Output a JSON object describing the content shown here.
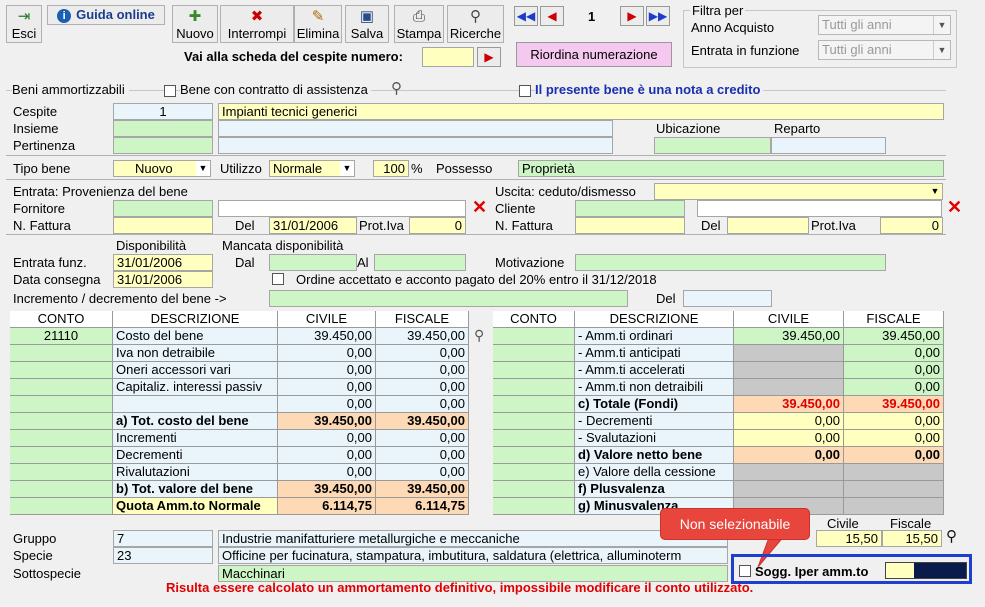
{
  "toolbar": {
    "esci": "Esci",
    "guida": "Guida online",
    "nuovo": "Nuovo",
    "interrompi": "Interrompi",
    "elimina": "Elimina",
    "salva": "Salva",
    "stampa": "Stampa",
    "ricerche": "Ricerche",
    "page": "1",
    "vai_label": "Vai alla scheda del cespite numero:",
    "riordina": "Riordina numerazione"
  },
  "filter": {
    "title": "Filtra per",
    "anno_label": "Anno Acquisto",
    "anno_value": "Tutti gli anni",
    "entrata_label": "Entrata in funzione",
    "entrata_value": "Tutti gli anni"
  },
  "beni": {
    "section": "Beni ammortizzabili",
    "assistenza": "Bene con contratto di assistenza",
    "nota_credito": "Il presente bene è una nota a credito",
    "cespite_label": "Cespite",
    "cespite_num": "1",
    "cespite_desc": "Impianti tecnici generici",
    "insieme_label": "Insieme",
    "pertinenza_label": "Pertinenza",
    "ubicazione_label": "Ubicazione",
    "reparto_label": "Reparto",
    "tipo_label": "Tipo bene",
    "tipo_value": "Nuovo",
    "utilizzo_label": "Utilizzo",
    "utilizzo_value": "Normale",
    "perc_value": "100",
    "perc_sign": "%",
    "possesso_label": "Possesso",
    "possesso_value": "Proprietà"
  },
  "entrata": {
    "provenienza": "Entrata: Provenienza del bene",
    "fornitore": "Fornitore",
    "nfattura": "N. Fattura",
    "del": "Del",
    "del_value": "31/01/2006",
    "protiva": "Prot.Iva",
    "protiva_value": "0"
  },
  "uscita": {
    "title": "Uscita: ceduto/dismesso",
    "cliente": "Cliente",
    "nfattura": "N. Fattura",
    "del": "Del",
    "protiva": "Prot.Iva",
    "protiva_value": "0"
  },
  "disp": {
    "disponibilita": "Disponibilità",
    "mancata": "Mancata disponibilità",
    "entrata_funz": "Entrata funz.",
    "entrata_funz_value": "31/01/2006",
    "data_consegna": "Data consegna",
    "data_consegna_value": "31/01/2006",
    "dal": "Dal",
    "al": "Al",
    "motivazione": "Motivazione",
    "ordine": "Ordine accettato e acconto pagato del 20% entro il 31/12/2018",
    "incremento": "Incremento / decremento del bene ->",
    "del": "Del"
  },
  "left_table": {
    "headers": [
      "CONTO",
      "DESCRIZIONE",
      "CIVILE",
      "FISCALE"
    ],
    "rows": [
      {
        "conto": "21110",
        "desc": "Costo del bene",
        "civile": "39.450,00",
        "fiscale": "39.450,00"
      },
      {
        "conto": "",
        "desc": "Iva non detraibile",
        "civile": "0,00",
        "fiscale": "0,00"
      },
      {
        "conto": "",
        "desc": "Oneri accessori vari",
        "civile": "0,00",
        "fiscale": "0,00"
      },
      {
        "conto": "",
        "desc": "Capitaliz. interessi passiv",
        "civile": "0,00",
        "fiscale": "0,00"
      },
      {
        "conto": "",
        "desc": "",
        "civile": "0,00",
        "fiscale": "0,00"
      },
      {
        "conto": "",
        "desc": "a) Tot. costo del bene",
        "civile": "39.450,00",
        "fiscale": "39.450,00"
      },
      {
        "conto": "",
        "desc": "Incrementi",
        "civile": "0,00",
        "fiscale": "0,00"
      },
      {
        "conto": "",
        "desc": "Decrementi",
        "civile": "0,00",
        "fiscale": "0,00"
      },
      {
        "conto": "",
        "desc": "Rivalutazioni",
        "civile": "0,00",
        "fiscale": "0,00"
      },
      {
        "conto": "",
        "desc": "b) Tot. valore del bene",
        "civile": "39.450,00",
        "fiscale": "39.450,00"
      },
      {
        "conto": "",
        "desc": "Quota Amm.to Normale",
        "civile": "6.114,75",
        "fiscale": "6.114,75"
      }
    ]
  },
  "right_table": {
    "headers": [
      "CONTO",
      "DESCRIZIONE",
      "CIVILE",
      "FISCALE"
    ],
    "rows": [
      {
        "desc": "- Amm.ti ordinari",
        "civile": "39.450,00",
        "fiscale": "39.450,00"
      },
      {
        "desc": "- Amm.ti anticipati",
        "civile": "",
        "fiscale": "0,00"
      },
      {
        "desc": "- Amm.ti accelerati",
        "civile": "",
        "fiscale": "0,00"
      },
      {
        "desc": "- Amm.ti non detraibili",
        "civile": "",
        "fiscale": "0,00"
      },
      {
        "desc": "c) Totale (Fondi)",
        "civile": "39.450,00",
        "fiscale": "39.450,00"
      },
      {
        "desc": "- Decrementi",
        "civile": "0,00",
        "fiscale": "0,00"
      },
      {
        "desc": "- Svalutazioni",
        "civile": "0,00",
        "fiscale": "0,00"
      },
      {
        "desc": "d) Valore netto bene",
        "civile": "0,00",
        "fiscale": "0,00"
      },
      {
        "desc": "e) Valore della cessione",
        "civile": "",
        "fiscale": ""
      },
      {
        "desc": "f) Plusvalenza",
        "civile": "",
        "fiscale": ""
      },
      {
        "desc": "g) Minusvalenza",
        "civile": "",
        "fiscale": ""
      }
    ]
  },
  "bottom": {
    "gruppo": "Gruppo",
    "gruppo_num": "7",
    "gruppo_desc": "Industrie manifatturiere metallurgiche e meccaniche",
    "specie": "Specie",
    "specie_num": "23",
    "specie_desc": "Officine per fucinatura, stampatura, imbutitura, saldatura (elettrica, alluminoterm",
    "sottospecie": "Sottospecie",
    "sottospecie_desc": "Macchinari",
    "civile": "Civile",
    "fiscale": "Fiscale",
    "civile_value": "15,50",
    "fiscale_value": "15,50",
    "callout": "Non selezionabile",
    "sogg": "Sogg. Iper amm.to",
    "warning": "Risulta essere calcolato un ammortamento definitivo, impossibile modificare il conto utilizzato."
  },
  "colors": {
    "green": "#cdf5c5",
    "yellow": "#ffffc0",
    "orange": "#fdd9b5",
    "red_text": "#e00000",
    "callout": "#e8453c",
    "highlight_border": "#1f3fd0"
  }
}
